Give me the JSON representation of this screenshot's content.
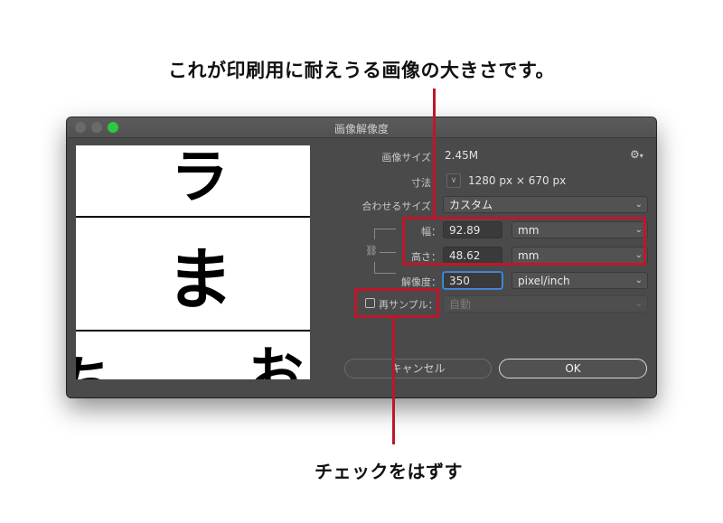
{
  "captions": {
    "top": "これが印刷用に耐えうる画像の大きさです。",
    "bottom": "チェックをはずす"
  },
  "dialog": {
    "title": "画像解像度",
    "image_size_label": "画像サイズ：",
    "image_size_value": "2.45M",
    "gear_icon": "⚙",
    "dimensions_label": "寸法：",
    "dimensions_value": "1280 px × 670 px",
    "fit_to_label": "合わせるサイズ：",
    "fit_to_value": "カスタム",
    "width_label": "幅：",
    "width_value": "92.89",
    "width_unit": "mm",
    "height_label": "高さ：",
    "height_value": "48.62",
    "height_unit": "mm",
    "resolution_label": "解像度：",
    "resolution_value": "350",
    "resolution_unit": "pixel/inch",
    "resample_label": "再サンプル：",
    "resample_value": "自動",
    "resample_checked": false,
    "cancel_label": "キャンセル",
    "ok_label": "OK"
  },
  "preview": {
    "glyphs": [
      "ラ",
      "ま",
      "ち",
      "お"
    ]
  },
  "colors": {
    "annotation_red": "#c0162b",
    "dialog_bg": "#4a4a4a",
    "zoom_button": "#2dc840"
  }
}
